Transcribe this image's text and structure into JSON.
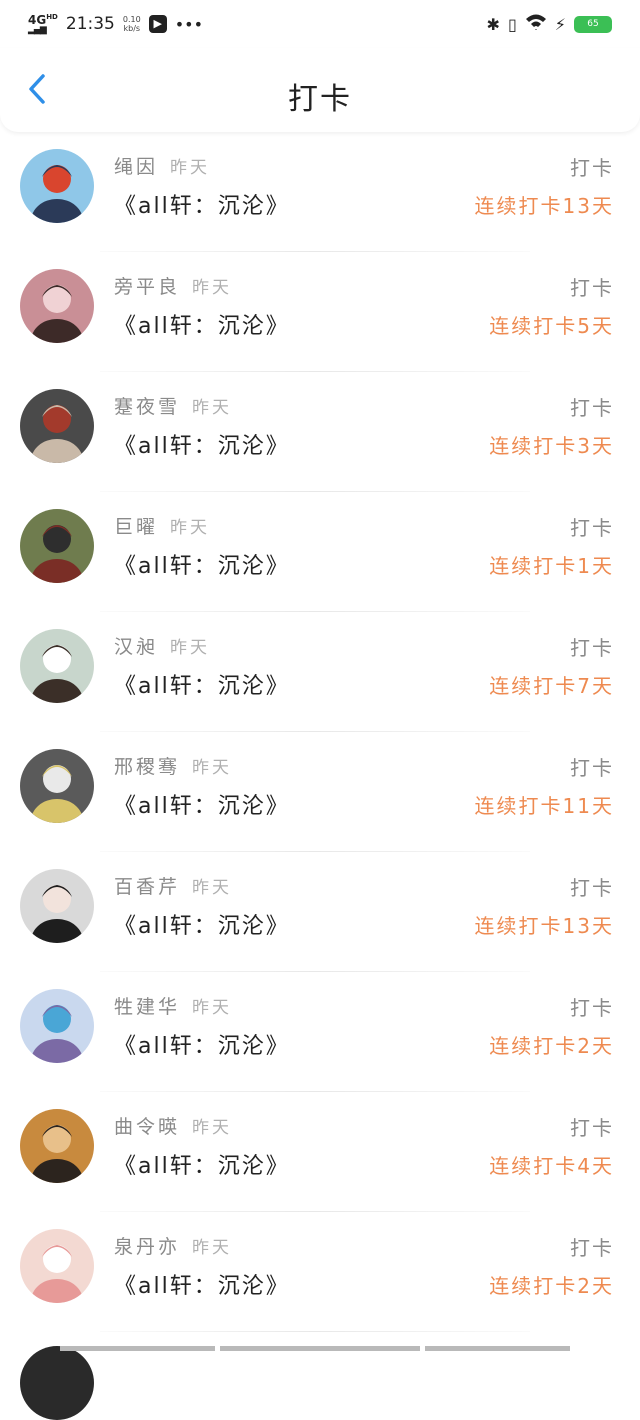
{
  "status_bar": {
    "network": "4G",
    "network_sup": "HD",
    "time": "21:35",
    "speed_value": "0.10",
    "speed_unit": "kb/s",
    "battery": "65"
  },
  "header": {
    "title": "打卡"
  },
  "rows": [
    {
      "name": "绳因",
      "when": "昨天",
      "book": "《all轩：沉沦》",
      "action": "打卡",
      "streak": "连续打卡13天",
      "avatar": {
        "bg": "#8fc7e8",
        "fg": "#2b3a58",
        "accent": "#d9452e"
      }
    },
    {
      "name": "旁平良",
      "when": "昨天",
      "book": "《all轩：沉沦》",
      "action": "打卡",
      "streak": "连续打卡5天",
      "avatar": {
        "bg": "#c98f96",
        "fg": "#3d2a28",
        "accent": "#f0d2d4"
      }
    },
    {
      "name": "蹇夜雪",
      "when": "昨天",
      "book": "《all轩：沉沦》",
      "action": "打卡",
      "streak": "连续打卡3天",
      "avatar": {
        "bg": "#4a4a4a",
        "fg": "#c9b9a8",
        "accent": "#a33a2c"
      }
    },
    {
      "name": "巨曜",
      "when": "昨天",
      "book": "《all轩：沉沦》",
      "action": "打卡",
      "streak": "连续打卡1天",
      "avatar": {
        "bg": "#6f7c4e",
        "fg": "#7a2e26",
        "accent": "#2e2e2e"
      }
    },
    {
      "name": "汉昶",
      "when": "昨天",
      "book": "《all轩：沉沦》",
      "action": "打卡",
      "streak": "连续打卡7天",
      "avatar": {
        "bg": "#c8d6cc",
        "fg": "#3b2f28",
        "accent": "#ffffff"
      }
    },
    {
      "name": "邢稷骞",
      "when": "昨天",
      "book": "《all轩：沉沦》",
      "action": "打卡",
      "streak": "连续打卡11天",
      "avatar": {
        "bg": "#5a5a5a",
        "fg": "#d8c46a",
        "accent": "#e9e9e9"
      }
    },
    {
      "name": "百香芹",
      "when": "昨天",
      "book": "《all轩：沉沦》",
      "action": "打卡",
      "streak": "连续打卡13天",
      "avatar": {
        "bg": "#d9d9d9",
        "fg": "#1e1e1e",
        "accent": "#f2e3dc"
      }
    },
    {
      "name": "牲建华",
      "when": "昨天",
      "book": "《all轩：沉沦》",
      "action": "打卡",
      "streak": "连续打卡2天",
      "avatar": {
        "bg": "#c9d8ee",
        "fg": "#7b6aa5",
        "accent": "#4aa6d6"
      }
    },
    {
      "name": "曲令暎",
      "when": "昨天",
      "book": "《all轩：沉沦》",
      "action": "打卡",
      "streak": "连续打卡4天",
      "avatar": {
        "bg": "#c88a3e",
        "fg": "#2c241e",
        "accent": "#e8c08a"
      }
    },
    {
      "name": "泉丹亦",
      "when": "昨天",
      "book": "《all轩：沉沦》",
      "action": "打卡",
      "streak": "连续打卡2天",
      "avatar": {
        "bg": "#f3d9d2",
        "fg": "#e79a98",
        "accent": "#ffffff"
      }
    }
  ],
  "colors": {
    "accent_back": "#2f8fe8",
    "streak": "#ee8a50",
    "muted": "#8a8a8a"
  }
}
